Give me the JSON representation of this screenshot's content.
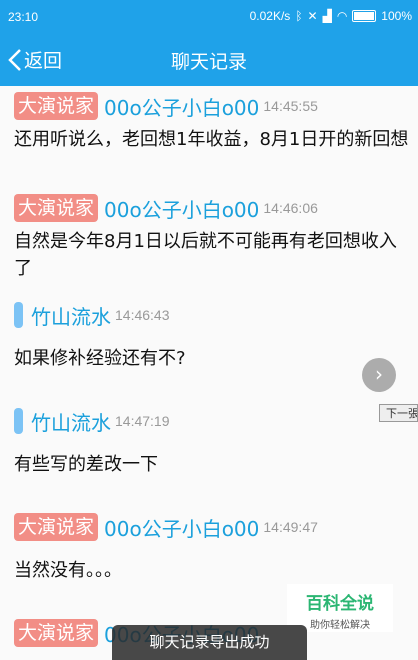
{
  "status_bar": {
    "time": "23:10",
    "network_speed": "0.02K/s",
    "battery": "100%"
  },
  "nav": {
    "back_label": "返回",
    "title": "聊天记录"
  },
  "messages": [
    {
      "role_tag": "大演说家",
      "sender": "00o公子小白o00",
      "time": "14:45:55",
      "text": "还用听说么，老回想1年收益，8月1日开的新回想"
    },
    {
      "role_tag": "大演说家",
      "sender": "00o公子小白o00",
      "time": "14:46:06",
      "text": "自然是今年8月1日以后就不可能再有老回想收入了"
    },
    {
      "role_tag": "",
      "sender": "竹山流水",
      "time": "14:46:43",
      "text": "如果修补经验还有不?"
    },
    {
      "role_tag": "",
      "sender": "竹山流水",
      "time": "14:47:19",
      "text": "有些写的差改一下"
    },
    {
      "role_tag": "大演说家",
      "sender": "00o公子小白o00",
      "time": "14:49:47",
      "text": "当然没有。。。"
    },
    {
      "role_tag": "大演说家",
      "sender": "00o公子小白o00",
      "time": "",
      "text": ""
    }
  ],
  "overlay": {
    "next_button": "›",
    "tooltip": "下一張"
  },
  "watermark": {
    "title": "百科全说",
    "subtitle": "助你轻松解决"
  },
  "toast": "聊天记录导出成功"
}
